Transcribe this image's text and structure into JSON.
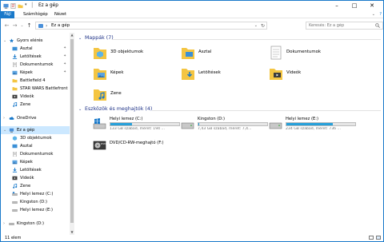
{
  "window": {
    "title": "Ez a gép"
  },
  "ribbon": {
    "tabs": [
      "Fájl",
      "Számítógép",
      "Nézet"
    ]
  },
  "address": {
    "crumb": "Ez a gép",
    "search_placeholder": "Keresés: Ez a gép"
  },
  "sidebar": {
    "quick_access": "Gyors elérés",
    "quick_items": [
      "Asztal",
      "Letöltések",
      "Dokumentumok",
      "Képek",
      "Battlefield 4",
      "STAR WARS Battlefront",
      "Videók",
      "Zene"
    ],
    "onedrive": "OneDrive",
    "this_pc": "Ez a gép",
    "pc_items": [
      "3D objektumok",
      "Asztal",
      "Dokumentumok",
      "Képek",
      "Letöltések",
      "Videók",
      "Zene",
      "Helyi lemez (C:)",
      "Kingston (D:)",
      "Helyi lemez (E:)"
    ],
    "kingston": "Kingston (D:)"
  },
  "folders": {
    "header": "Mappák (7)",
    "items": [
      "3D objektumok",
      "Asztal",
      "Dokumentumok",
      "Képek",
      "Letöltések",
      "Videók",
      "Zene"
    ]
  },
  "devices": {
    "header": "Eszközök és meghajtók (4)",
    "drives": [
      {
        "name": "Helyi lemez (C:)",
        "free": "133 GB szabad, méret: 194 ...",
        "used": 0.31,
        "color": "#26a0da"
      },
      {
        "name": "Kingston (D:)",
        "free": "7,43 GB szabad, méret: 7,4...",
        "used": 0.01,
        "color": "#26a0da"
      },
      {
        "name": "Helyi lemez (E:)",
        "free": "234 GB szabad, méret: 736 ...",
        "used": 0.68,
        "color": "#26a0da"
      }
    ],
    "dvd": "DVD/CD-RW-meghajtó (F:)"
  },
  "status": {
    "count": "11 elem"
  },
  "colors": {
    "accent": "#1979ca",
    "folder": "#f4c542",
    "header": "#1e3287"
  }
}
